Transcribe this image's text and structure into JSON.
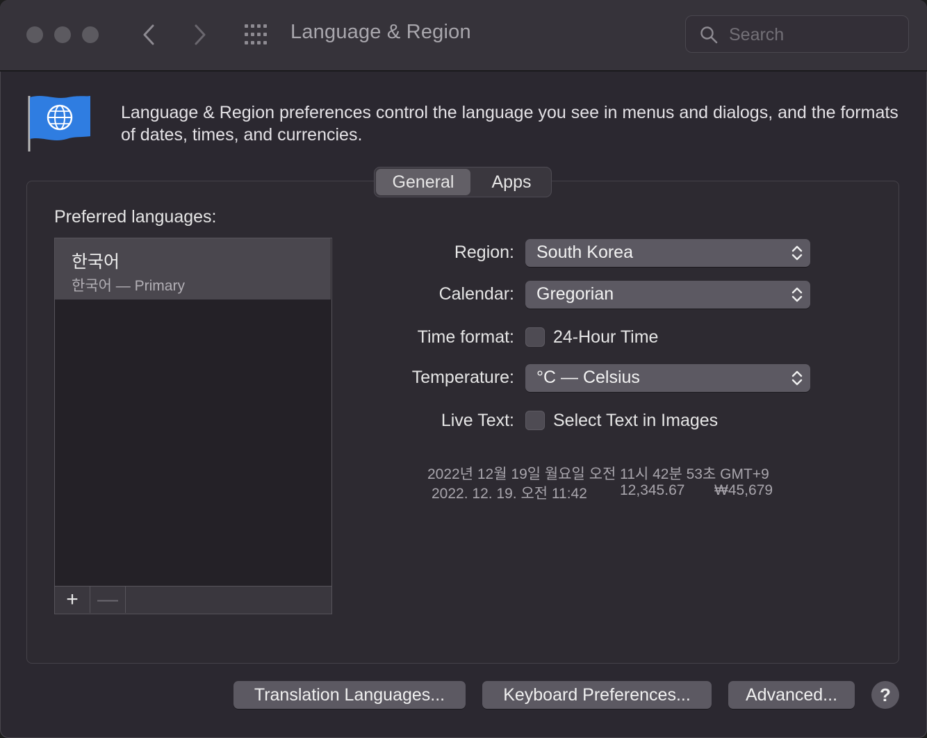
{
  "window": {
    "title": "Language & Region"
  },
  "search": {
    "placeholder": "Search"
  },
  "header": {
    "description": "Language & Region preferences control the language you see in menus and dialogs, and the formats of dates, times, and currencies."
  },
  "tabs": [
    {
      "label": "General",
      "active": true
    },
    {
      "label": "Apps",
      "active": false
    }
  ],
  "preferred_languages": {
    "label": "Preferred languages:",
    "items": [
      {
        "name": "한국어",
        "subtitle": "한국어 — Primary",
        "selected": true
      }
    ],
    "add_label": "+",
    "remove_label": "—"
  },
  "settings": {
    "region": {
      "label": "Region:",
      "value": "South Korea"
    },
    "calendar": {
      "label": "Calendar:",
      "value": "Gregorian"
    },
    "time_format": {
      "label": "Time format:",
      "checkbox_label": "24-Hour Time",
      "checked": false
    },
    "temperature": {
      "label": "Temperature:",
      "value": "°C — Celsius"
    },
    "live_text": {
      "label": "Live Text:",
      "checkbox_label": "Select Text in Images",
      "checked": false
    }
  },
  "sample": {
    "long_date": "2022년 12월 19일 월요일 오전 11시 42분 53초 GMT+9",
    "short_date": "2022. 12. 19. 오전 11:42",
    "number": "12,345.67",
    "currency": "₩45,679"
  },
  "buttons": {
    "translation": "Translation Languages...",
    "keyboard": "Keyboard Preferences...",
    "advanced": "Advanced...",
    "help": "?"
  },
  "colors": {
    "window_bg": "#2b2830",
    "titlebar_bg": "#36333a",
    "popup_bg": "#5c5962",
    "flag_blue": "#2f7de1"
  }
}
